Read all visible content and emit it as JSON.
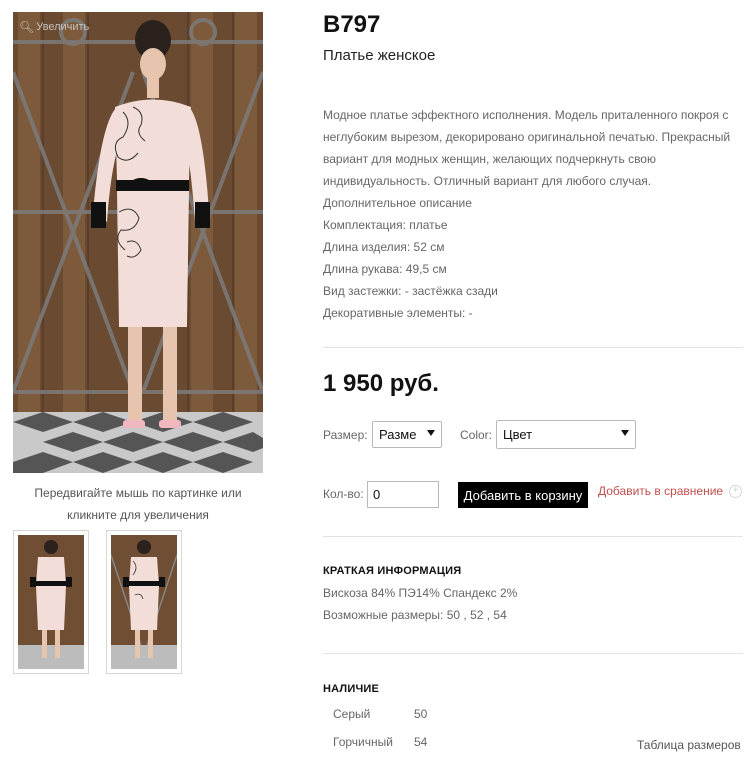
{
  "product": {
    "sku": "B797",
    "subtitle": "Платье женское",
    "description": [
      "Модное платье эффектного исполнения. Модель приталенного покроя с",
      "неглубоким вырезом, декорировано оригинальной печатью. Прекрасный",
      "вариант для модных женщин, желающих подчеркнуть свою",
      "индивидуальность. Отличный вариант для любого случая.",
      "Дополнительное описание",
      "Комплектация: платье",
      "Длина изделия: 52 см",
      "Длина рукава: 49,5 см",
      "Вид застежки: - застёжка сзади",
      "Декоративные элементы: -"
    ],
    "price": "1 950 руб."
  },
  "gallery": {
    "zoom_hint": "Увеличить",
    "zoom_icon": "magnifier-icon",
    "caption_line1": "Передвигайте мышь по картинке или",
    "caption_line2": "кликните для увеличения"
  },
  "options": {
    "size_label": "Размер:",
    "size_value": "Разме",
    "color_label": "Color:",
    "color_value": "Цвет"
  },
  "purchase": {
    "qty_label": "Кол-во:",
    "qty_value": "0",
    "add_to_cart": "Добавить в корзину",
    "add_to_compare": "Добавить в сравнение"
  },
  "brief": {
    "title": "КРАТКАЯ ИНФОРМАЦИЯ",
    "composition": "Вискоза 84% ПЭ14% Спандекс 2%",
    "sizes": "Возможные размеры: 50 , 52 , 54"
  },
  "availability": {
    "title": "НАЛИЧИЕ",
    "rows": [
      {
        "color": "Серый",
        "size": "50"
      },
      {
        "color": "Горчичный",
        "size": "54"
      }
    ],
    "size_table_link": "Таблица размеров"
  },
  "colors": {
    "accent_link": "#c0504d",
    "button_bg": "#000000",
    "dress": "#f2ddd8"
  }
}
